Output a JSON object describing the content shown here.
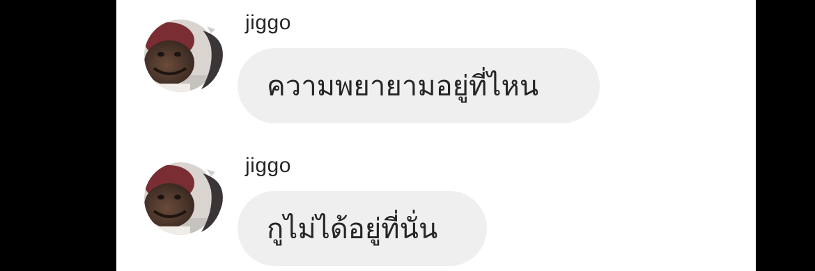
{
  "conversation": {
    "messages": [
      {
        "sender": "jiggo",
        "text": "ความพยายามอยู่ที่ไหน",
        "avatar_icon": "user-avatar-photo"
      },
      {
        "sender": "jiggo",
        "text": "กูไม่ได้อยู่ที่นั่น",
        "avatar_icon": "user-avatar-photo"
      }
    ]
  },
  "colors": {
    "background": "#000000",
    "panel": "#ffffff",
    "bubble": "#efefef",
    "text": "#262626"
  }
}
